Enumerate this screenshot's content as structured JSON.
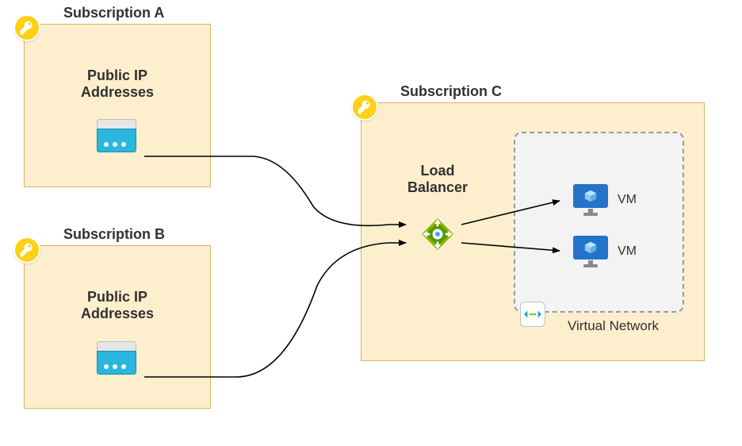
{
  "subscriptions": {
    "a": {
      "title": "Subscription A",
      "resource_label": "Public IP\nAddresses"
    },
    "b": {
      "title": "Subscription B",
      "resource_label": "Public IP\nAddresses"
    },
    "c": {
      "title": "Subscription C",
      "load_balancer_label": "Load\nBalancer",
      "vnet_label": "Virtual Network",
      "vms": [
        {
          "label": "VM"
        },
        {
          "label": "VM"
        }
      ]
    }
  }
}
